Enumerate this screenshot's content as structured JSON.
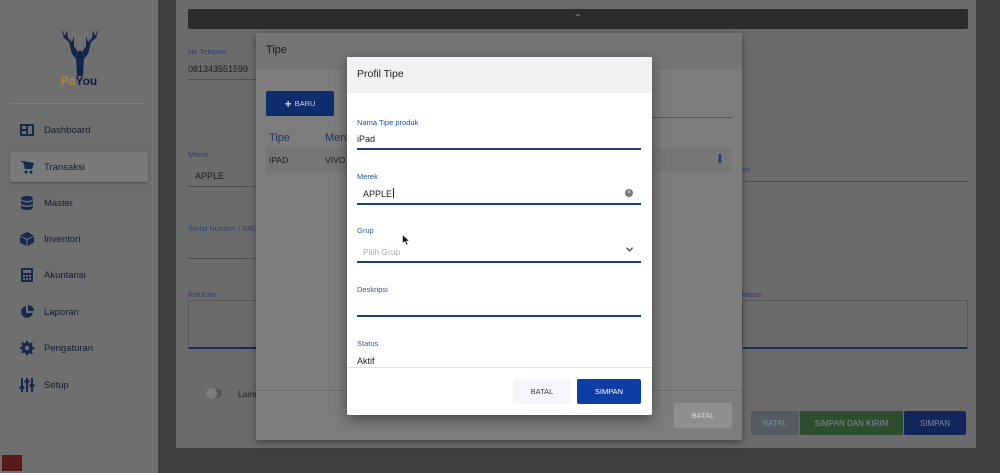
{
  "app": {
    "brand_prefix": "Pa",
    "brand_suffix": "You"
  },
  "sidebar": {
    "items": [
      {
        "label": "Dashboard",
        "icon": "dashboard-icon"
      },
      {
        "label": "Transaksi",
        "icon": "cart-icon",
        "active": true
      },
      {
        "label": "Master",
        "icon": "database-icon"
      },
      {
        "label": "Inventori",
        "icon": "box-icon"
      },
      {
        "label": "Akuntansi",
        "icon": "calculator-icon"
      },
      {
        "label": "Laporan",
        "icon": "pie-chart-icon"
      },
      {
        "label": "Pengaturan",
        "icon": "gear-icon"
      },
      {
        "label": "Setup",
        "icon": "sliders-icon"
      }
    ]
  },
  "form": {
    "phone_label": "No Telepon",
    "phone_value": "081343551599",
    "merek_label": "Merek",
    "merek_value": "APPLE",
    "serial_label": "Serial Number / IMEI",
    "keluhan_label": "Keluhan",
    "right_label_1": "eri",
    "right_label_2": "kapan",
    "lainnya_label": "Lainnya",
    "batal_label": "BATAL",
    "simpan_kirim_label": "SIMPAN DAN KIRIM",
    "simpan_label": "SIMPAN",
    "collapse_icon": "chevron-up-icon"
  },
  "tipe_dialog": {
    "title": "Tipe",
    "baru_label": "BARU",
    "columns": [
      "Tipe",
      "Merek"
    ],
    "rows": [
      {
        "tipe": "IPAD",
        "merek": "VIVO"
      }
    ],
    "batal_label": "BATAL"
  },
  "profil_dialog": {
    "title": "Profil Tipe",
    "nama_label": "Nama Tipe produk",
    "nama_value": "iPad",
    "merek_label": "Merek",
    "merek_value": "APPLE",
    "grup_label": "Grup",
    "grup_placeholder": "Pilih Grup",
    "deskripsi_label": "Deskripsi",
    "deskripsi_value": "",
    "status_label": "Status",
    "status_value": "Aktif",
    "batal_label": "BATAL",
    "simpan_label": "SIMPAN"
  },
  "colors": {
    "primary": "#0f3fa5",
    "sidebar_icon": "#16284e",
    "overlay": "#3f3f3f"
  }
}
